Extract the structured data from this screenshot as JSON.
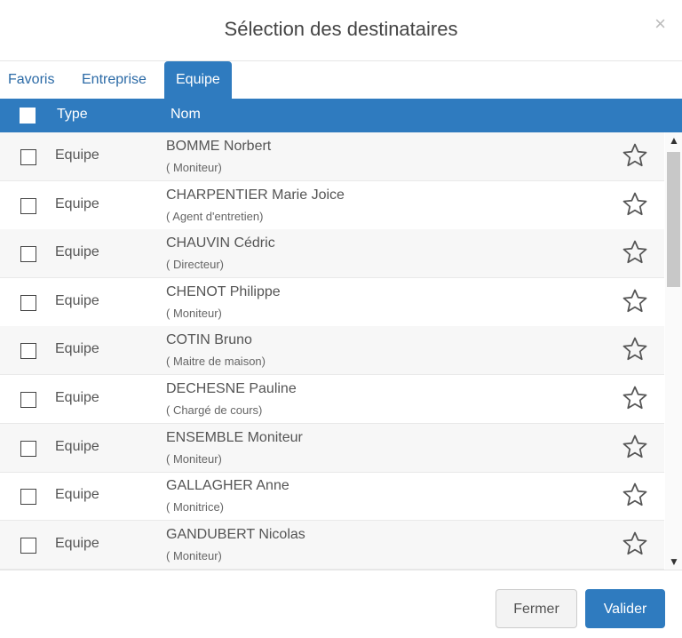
{
  "dialog": {
    "title": "Sélection des destinataires",
    "close_label": "×"
  },
  "tabs": [
    {
      "label": "Favoris",
      "active": false
    },
    {
      "label": "Entreprise",
      "active": false
    },
    {
      "label": "Equipe",
      "active": true
    }
  ],
  "table": {
    "columns": {
      "type": "Type",
      "nom": "Nom"
    },
    "rows": [
      {
        "type": "Equipe",
        "name": "BOMME Norbert",
        "role": "( Moniteur)"
      },
      {
        "type": "Equipe",
        "name": "CHARPENTIER Marie Joice",
        "role": "( Agent d'entretien)"
      },
      {
        "type": "Equipe",
        "name": "CHAUVIN Cédric",
        "role": "( Directeur)"
      },
      {
        "type": "Equipe",
        "name": "CHENOT Philippe",
        "role": "( Moniteur)"
      },
      {
        "type": "Equipe",
        "name": "COTIN Bruno",
        "role": "( Maitre de maison)"
      },
      {
        "type": "Equipe",
        "name": "DECHESNE Pauline",
        "role": "( Chargé de cours)"
      },
      {
        "type": "Equipe",
        "name": "ENSEMBLE Moniteur",
        "role": "( Moniteur)"
      },
      {
        "type": "Equipe",
        "name": "GALLAGHER Anne",
        "role": "( Monitrice)"
      },
      {
        "type": "Equipe",
        "name": "GANDUBERT Nicolas",
        "role": "( Moniteur)"
      }
    ]
  },
  "footer": {
    "close_button": "Fermer",
    "validate_button": "Valider"
  },
  "colors": {
    "accent": "#2f7bbf"
  }
}
